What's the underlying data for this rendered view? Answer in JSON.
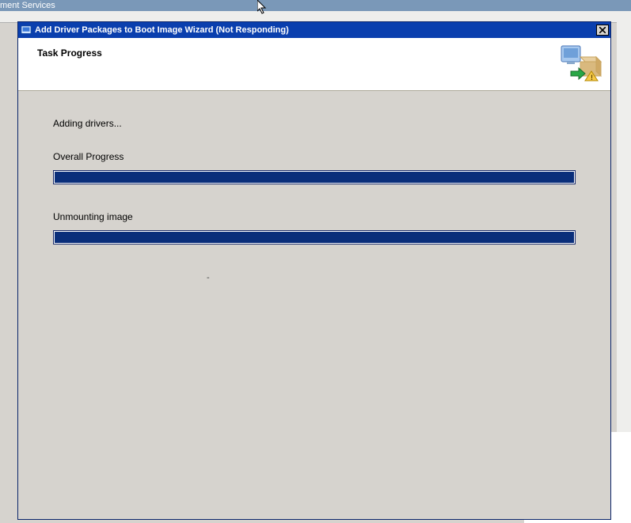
{
  "background": {
    "parent_title_fragment": "ment Services"
  },
  "dialog": {
    "title": "Add Driver Packages to Boot Image Wizard (Not Responding)",
    "heading": "Task Progress"
  },
  "content": {
    "status": "Adding drivers...",
    "overall_label": "Overall Progress",
    "overall_percent": 100,
    "stage_label": "Unmounting image",
    "stage_percent": 100,
    "tiny_mark": "-"
  }
}
